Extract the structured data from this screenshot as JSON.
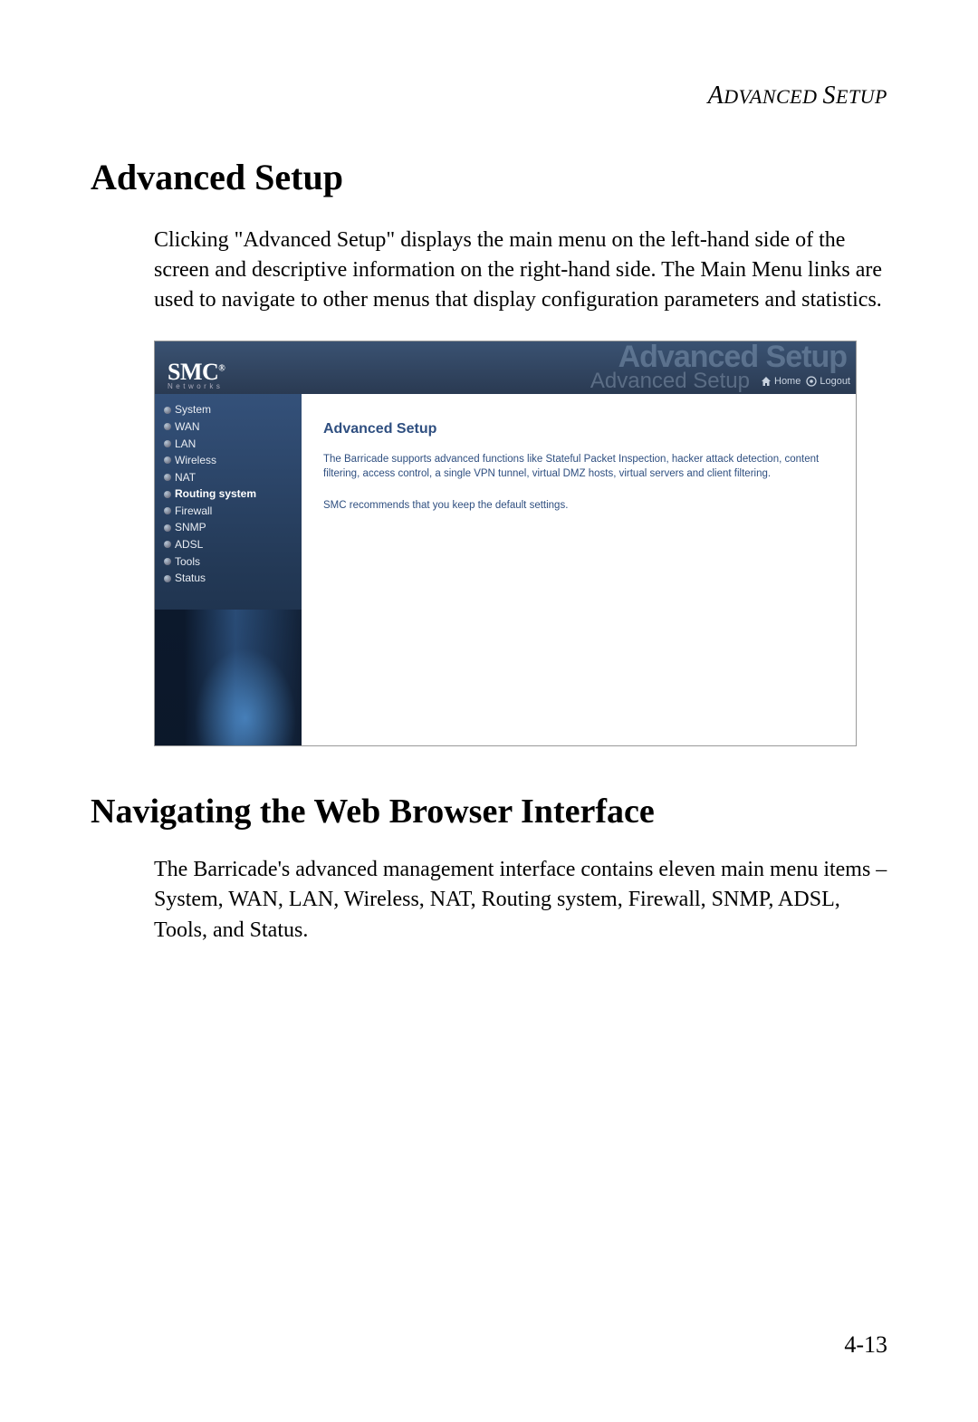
{
  "header": {
    "running_title": "Advanced Setup"
  },
  "sections": {
    "advanced_setup": {
      "title": "Advanced Setup",
      "body": "Clicking \"Advanced Setup\" displays the main menu on the left-hand side of the screen and descriptive information on the right-hand side. The Main Menu links are used to navigate to other menus that display configuration parameters and statistics."
    },
    "navigating": {
      "title": "Navigating the Web Browser Interface",
      "body": "The Barricade's advanced management interface contains eleven main menu items – System, WAN, LAN, Wireless, NAT, Routing system, Firewall, SNMP, ADSL, Tools, and Status."
    }
  },
  "screenshot": {
    "brand": "SMC",
    "brand_reg": "®",
    "brand_sub": "Networks",
    "watermark": "Advanced Setup",
    "title": "Advanced Setup",
    "buttons": {
      "home": "Home",
      "logout": "Logout"
    },
    "nav": [
      {
        "label": "System",
        "active": false
      },
      {
        "label": "WAN",
        "active": false
      },
      {
        "label": "LAN",
        "active": false
      },
      {
        "label": "Wireless",
        "active": false
      },
      {
        "label": "NAT",
        "active": false
      },
      {
        "label": "Routing system",
        "active": true
      },
      {
        "label": "Firewall",
        "active": false
      },
      {
        "label": "SNMP",
        "active": false
      },
      {
        "label": "ADSL",
        "active": false
      },
      {
        "label": "Tools",
        "active": false
      },
      {
        "label": "Status",
        "active": false
      }
    ],
    "content_title": "Advanced Setup",
    "content_p1": "The Barricade supports advanced functions like Stateful Packet Inspection, hacker attack detection, content filtering, access control, a single VPN tunnel, virtual DMZ hosts, virtual servers and client filtering.",
    "content_p2": "SMC recommends that you keep the default settings."
  },
  "page_number": "4-13"
}
